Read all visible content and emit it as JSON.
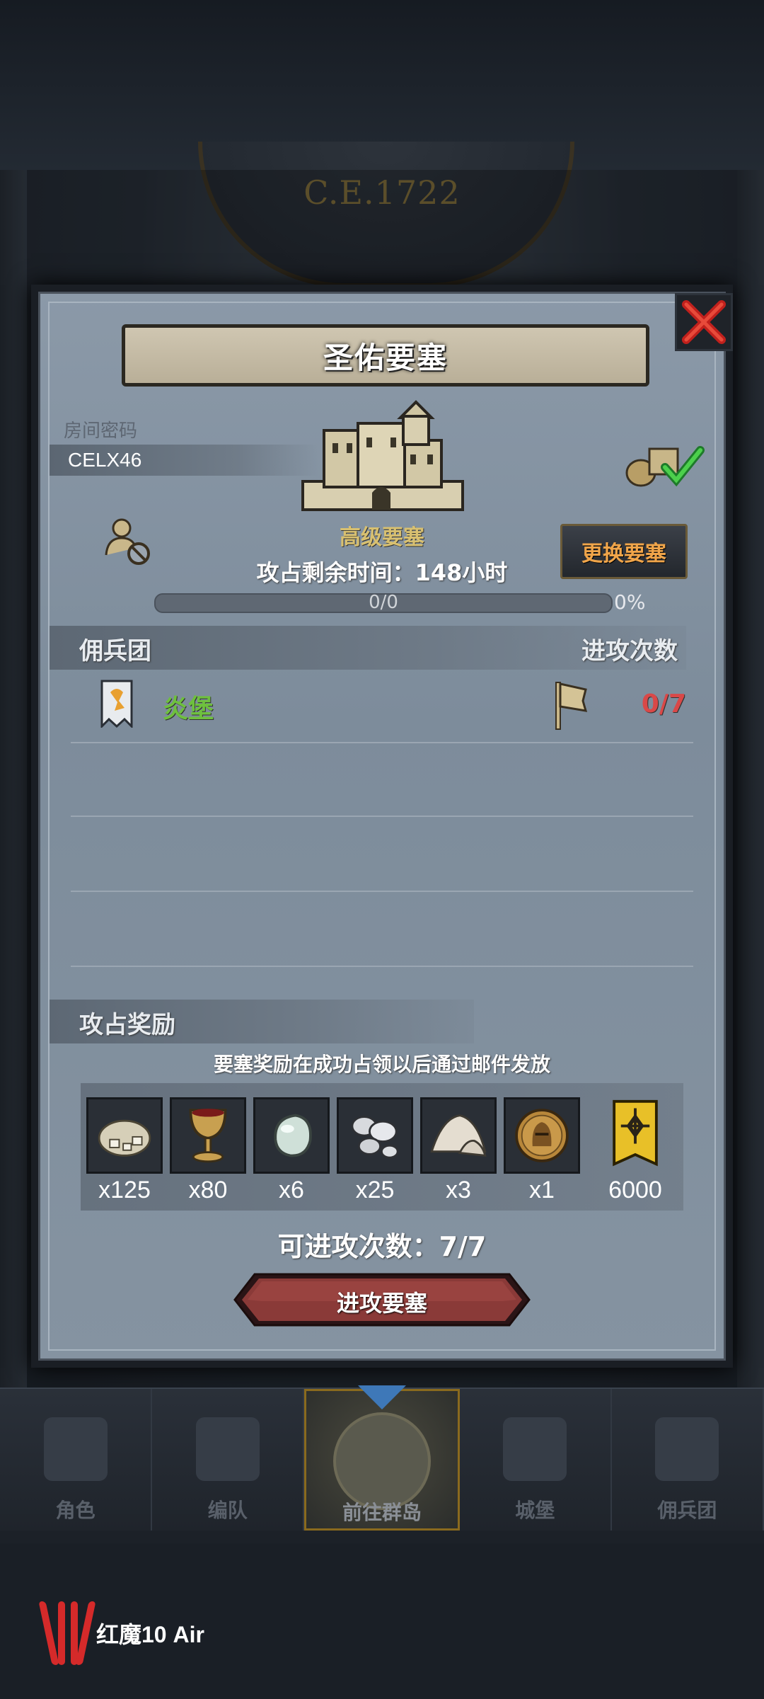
{
  "background": {
    "era_label": "C.E.1722"
  },
  "dialog": {
    "title": "圣佑要塞",
    "room_code_label": "房间密码",
    "room_code": "CELX46",
    "fortress_type": "高级要塞",
    "change_button": "更换要塞",
    "time_left": "攻占剩余时间：148小时",
    "progress": {
      "text": "0/0",
      "percent_text": "0%",
      "fraction": 0
    },
    "mercenary_header": "佣兵团",
    "attack_count_header": "进攻次数",
    "mercenaries": [
      {
        "name": "炎堡",
        "attacks": "0/7"
      }
    ],
    "rewards_header": "攻占奖励",
    "rewards_note": "要塞奖励在成功占领以后通过邮件发放",
    "rewards": [
      {
        "icon": "ore-icon",
        "qty": "x125"
      },
      {
        "icon": "goblet-icon",
        "qty": "x80"
      },
      {
        "icon": "gem-icon",
        "qty": "x6"
      },
      {
        "icon": "silver-ingots-icon",
        "qty": "x25"
      },
      {
        "icon": "salt-pile-icon",
        "qty": "x3"
      },
      {
        "icon": "knight-medal-icon",
        "qty": "x1"
      },
      {
        "icon": "honor-banner-icon",
        "qty": "6000"
      }
    ],
    "attacks_available": "可进攻次数：7/7",
    "attack_button": "进攻要塞"
  },
  "bottom_nav": {
    "items": [
      {
        "label": "角色",
        "active": false
      },
      {
        "label": "编队",
        "active": false
      },
      {
        "label": "前往群岛",
        "active": true
      },
      {
        "label": "城堡",
        "active": false
      },
      {
        "label": "佣兵团",
        "active": false
      }
    ]
  },
  "device_brand": "红魔10 Air",
  "colors": {
    "panel": "#8593a1",
    "accent_gold": "#d8c070",
    "accent_orange": "#f0a54a",
    "merc_green": "#6ec03e",
    "attack_red": "#d94848",
    "button_red": "#8a3a38"
  }
}
